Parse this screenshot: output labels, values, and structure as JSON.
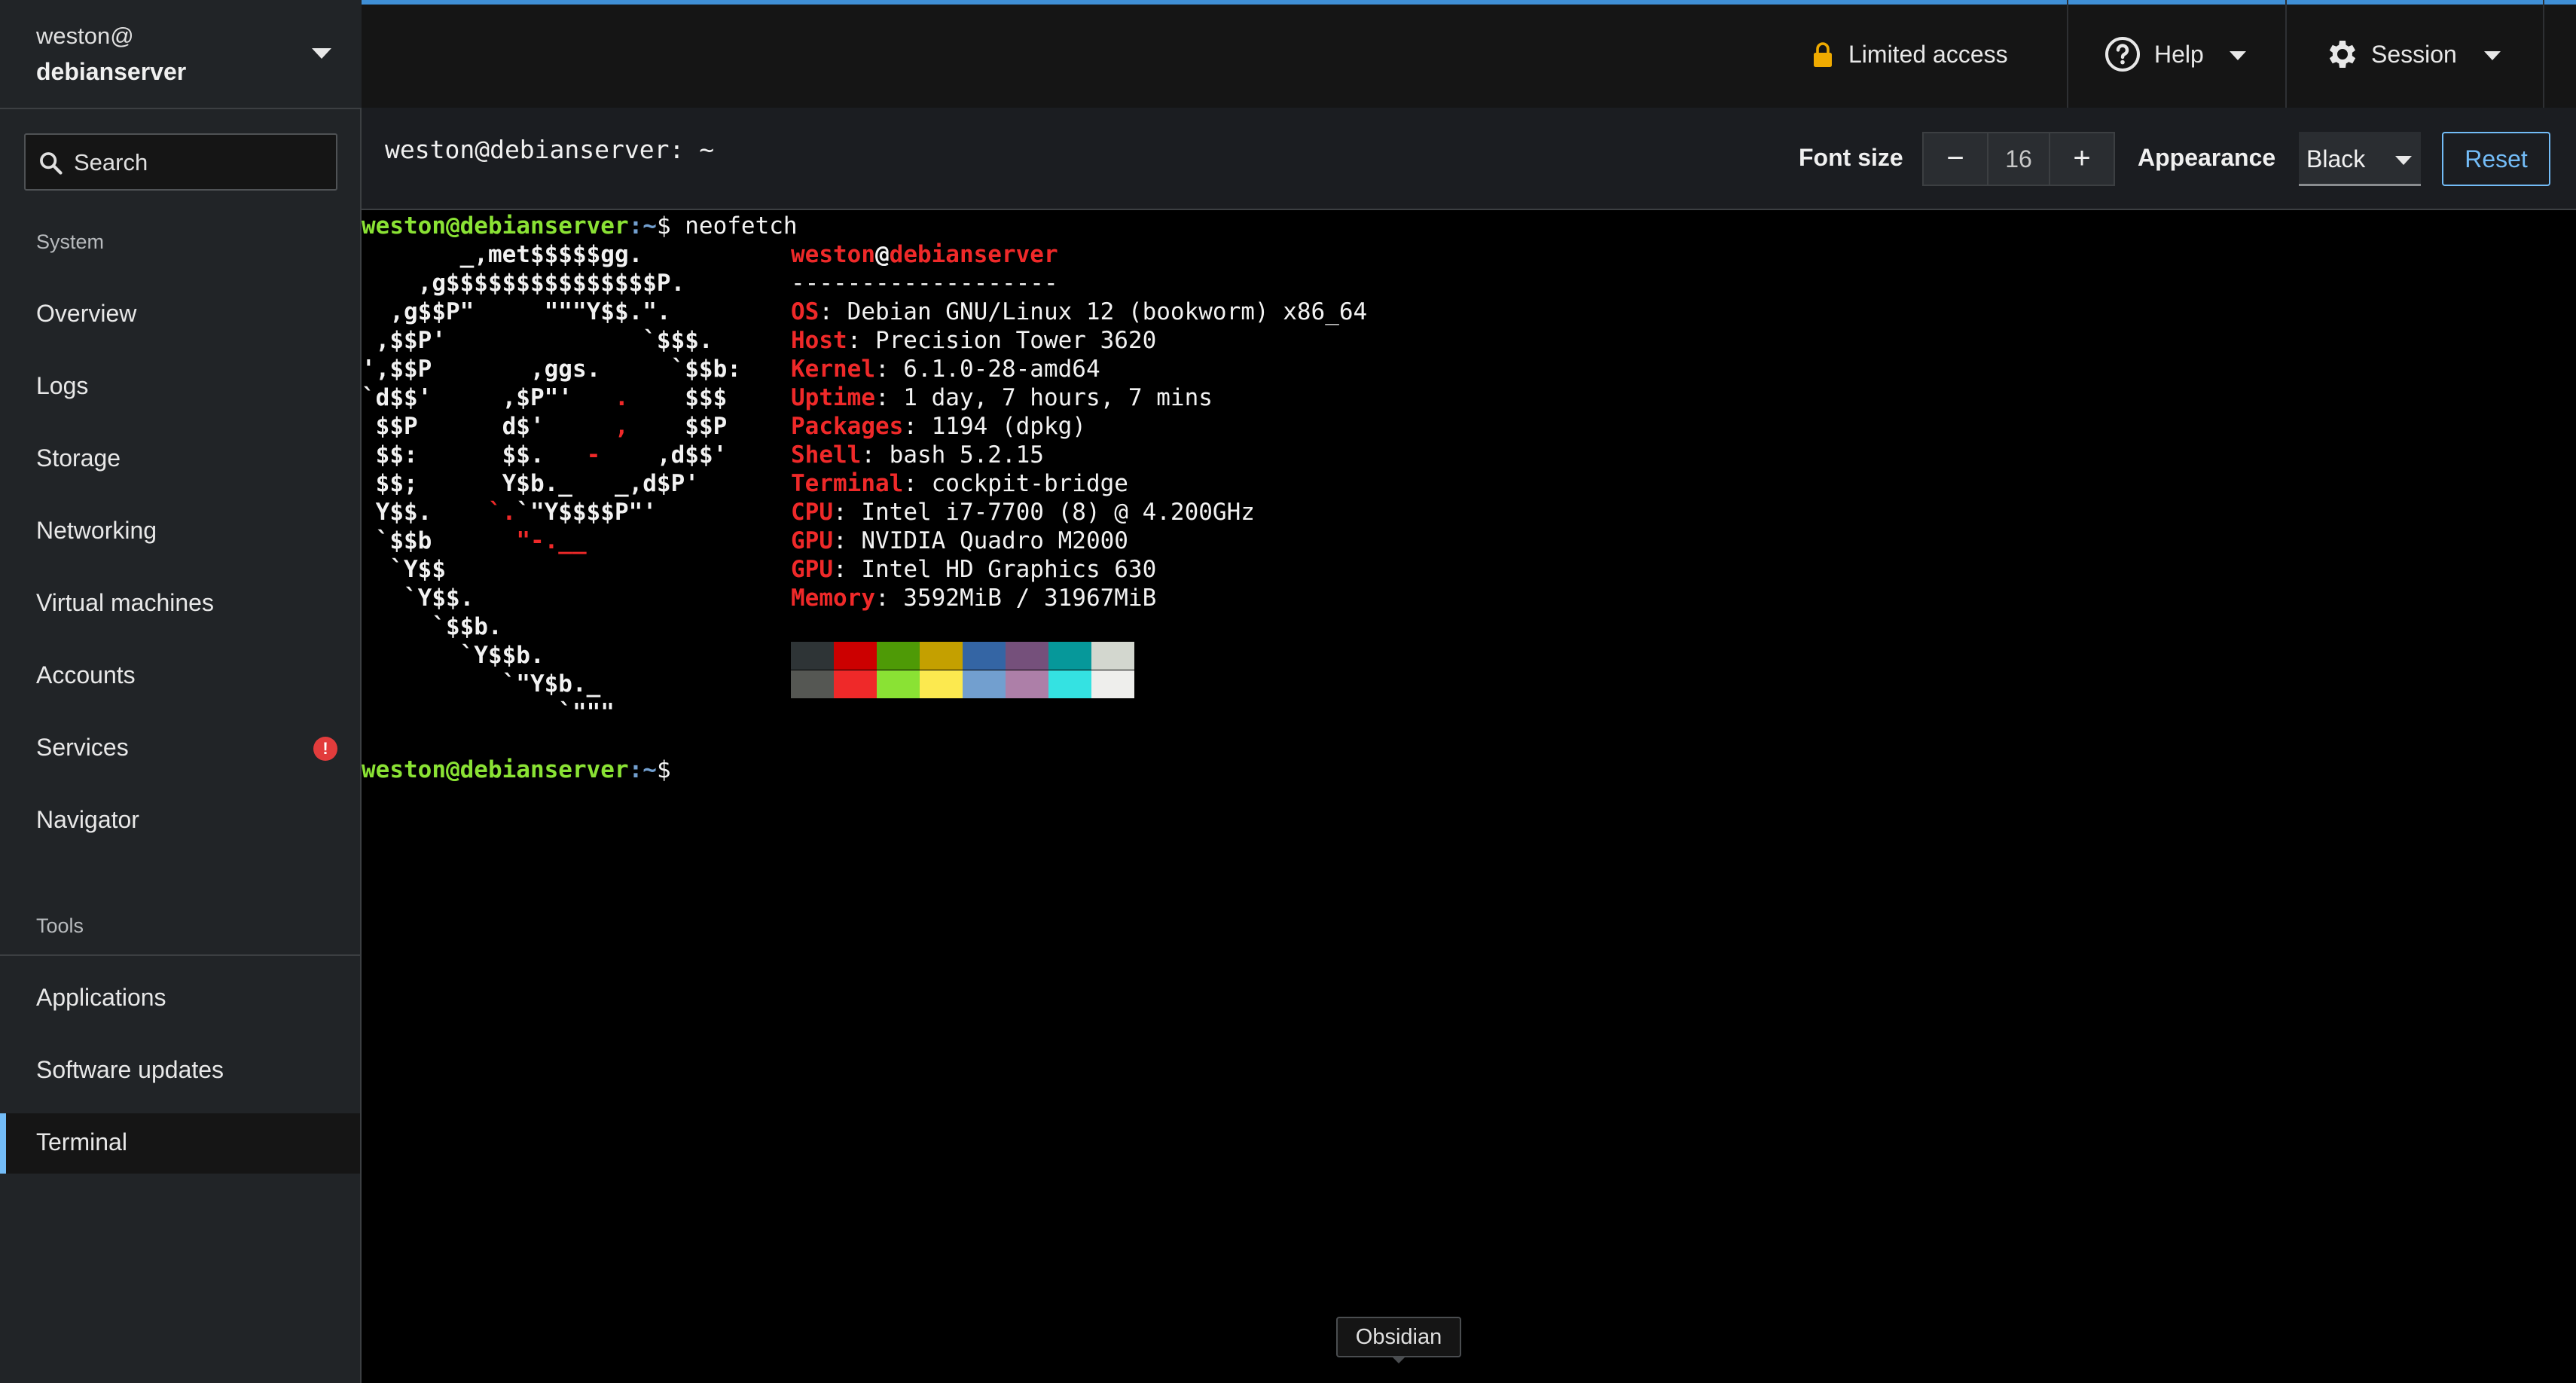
{
  "sidebar": {
    "host_user": "weston@",
    "host_name": "debianserver",
    "search_label": "Search",
    "system_heading": "System",
    "system_items": [
      {
        "label": "Overview"
      },
      {
        "label": "Logs"
      },
      {
        "label": "Storage"
      },
      {
        "label": "Networking"
      },
      {
        "label": "Virtual machines"
      },
      {
        "label": "Accounts"
      },
      {
        "label": "Services",
        "badge": "!"
      },
      {
        "label": "Navigator"
      }
    ],
    "tools_heading": "Tools",
    "tools_items": [
      {
        "label": "Applications"
      },
      {
        "label": "Software updates"
      },
      {
        "label": "Terminal",
        "active": true
      }
    ]
  },
  "masthead": {
    "limited_access": "Limited access",
    "help": "Help",
    "session": "Session"
  },
  "toolbar": {
    "title": "weston@debianserver: ~",
    "font_size_label": "Font size",
    "font_size_value": "16",
    "decrement": "−",
    "increment": "+",
    "appearance_label": "Appearance",
    "appearance_value": "Black",
    "reset_label": "Reset"
  },
  "terminal": {
    "prompt_user": "weston@debianserver",
    "prompt_path": ":~",
    "prompt_symbol": "$ ",
    "command": "neofetch",
    "logo_lines": [
      "       _,met$$$$$gg.",
      "    ,g$$$$$$$$$$$$$$$P.",
      "  ,g$$P\"     \"\"\"Y$$.\".",
      " ,$$P'              `$$$.",
      "',$$P       ,ggs.     `$$b:",
      "`d$$'     ,$P\"'   .    $$$",
      " $$P      d$'     ,    $$P",
      " $$:      $$.   -    ,d$$'",
      " $$;      Y$b._   _,d$P'",
      " Y$$.    `.`\"Y$$$$P\"'",
      " `$$b      \"-.__",
      "  `Y$$",
      "   `Y$$.",
      "     `$$b.",
      "       `Y$$b.",
      "          `\"Y$b._",
      "              `\"\"\""
    ],
    "user_host_user": "weston",
    "user_host_at": "@",
    "user_host_host": "debianserver",
    "separator": "-------------------",
    "info": [
      {
        "key": "OS",
        "value": ": Debian GNU/Linux 12 (bookworm) x86_64"
      },
      {
        "key": "Host",
        "value": ": Precision Tower 3620"
      },
      {
        "key": "Kernel",
        "value": ": 6.1.0-28-amd64"
      },
      {
        "key": "Uptime",
        "value": ": 1 day, 7 hours, 7 mins"
      },
      {
        "key": "Packages",
        "value": ": 1194 (dpkg)"
      },
      {
        "key": "Shell",
        "value": ": bash 5.2.15"
      },
      {
        "key": "Terminal",
        "value": ": cockpit-bridge"
      },
      {
        "key": "CPU",
        "value": ": Intel i7-7700 (8) @ 4.200GHz"
      },
      {
        "key": "GPU",
        "value": ": NVIDIA Quadro M2000"
      },
      {
        "key": "GPU",
        "value": ": Intel HD Graphics 630"
      },
      {
        "key": "Memory",
        "value": ": 3592MiB / 31967MiB"
      }
    ],
    "palette_top": [
      "#2e3436",
      "#cc0000",
      "#4e9a06",
      "#c4a000",
      "#3465a4",
      "#75507b",
      "#06989a",
      "#d3d7cf"
    ],
    "palette_bottom": [
      "#555753",
      "#ef2929",
      "#8ae234",
      "#fce94f",
      "#729fcf",
      "#ad7fa8",
      "#34e2e2",
      "#eeeeec"
    ]
  },
  "tooltip": "Obsidian",
  "colors": {
    "accent": "#73bcf7",
    "progress": "#3f8fd6",
    "prompt_green": "#8ae234",
    "prompt_blue": "#729fcf",
    "info_red": "#ef2929",
    "badge_red": "#e23c3c"
  }
}
